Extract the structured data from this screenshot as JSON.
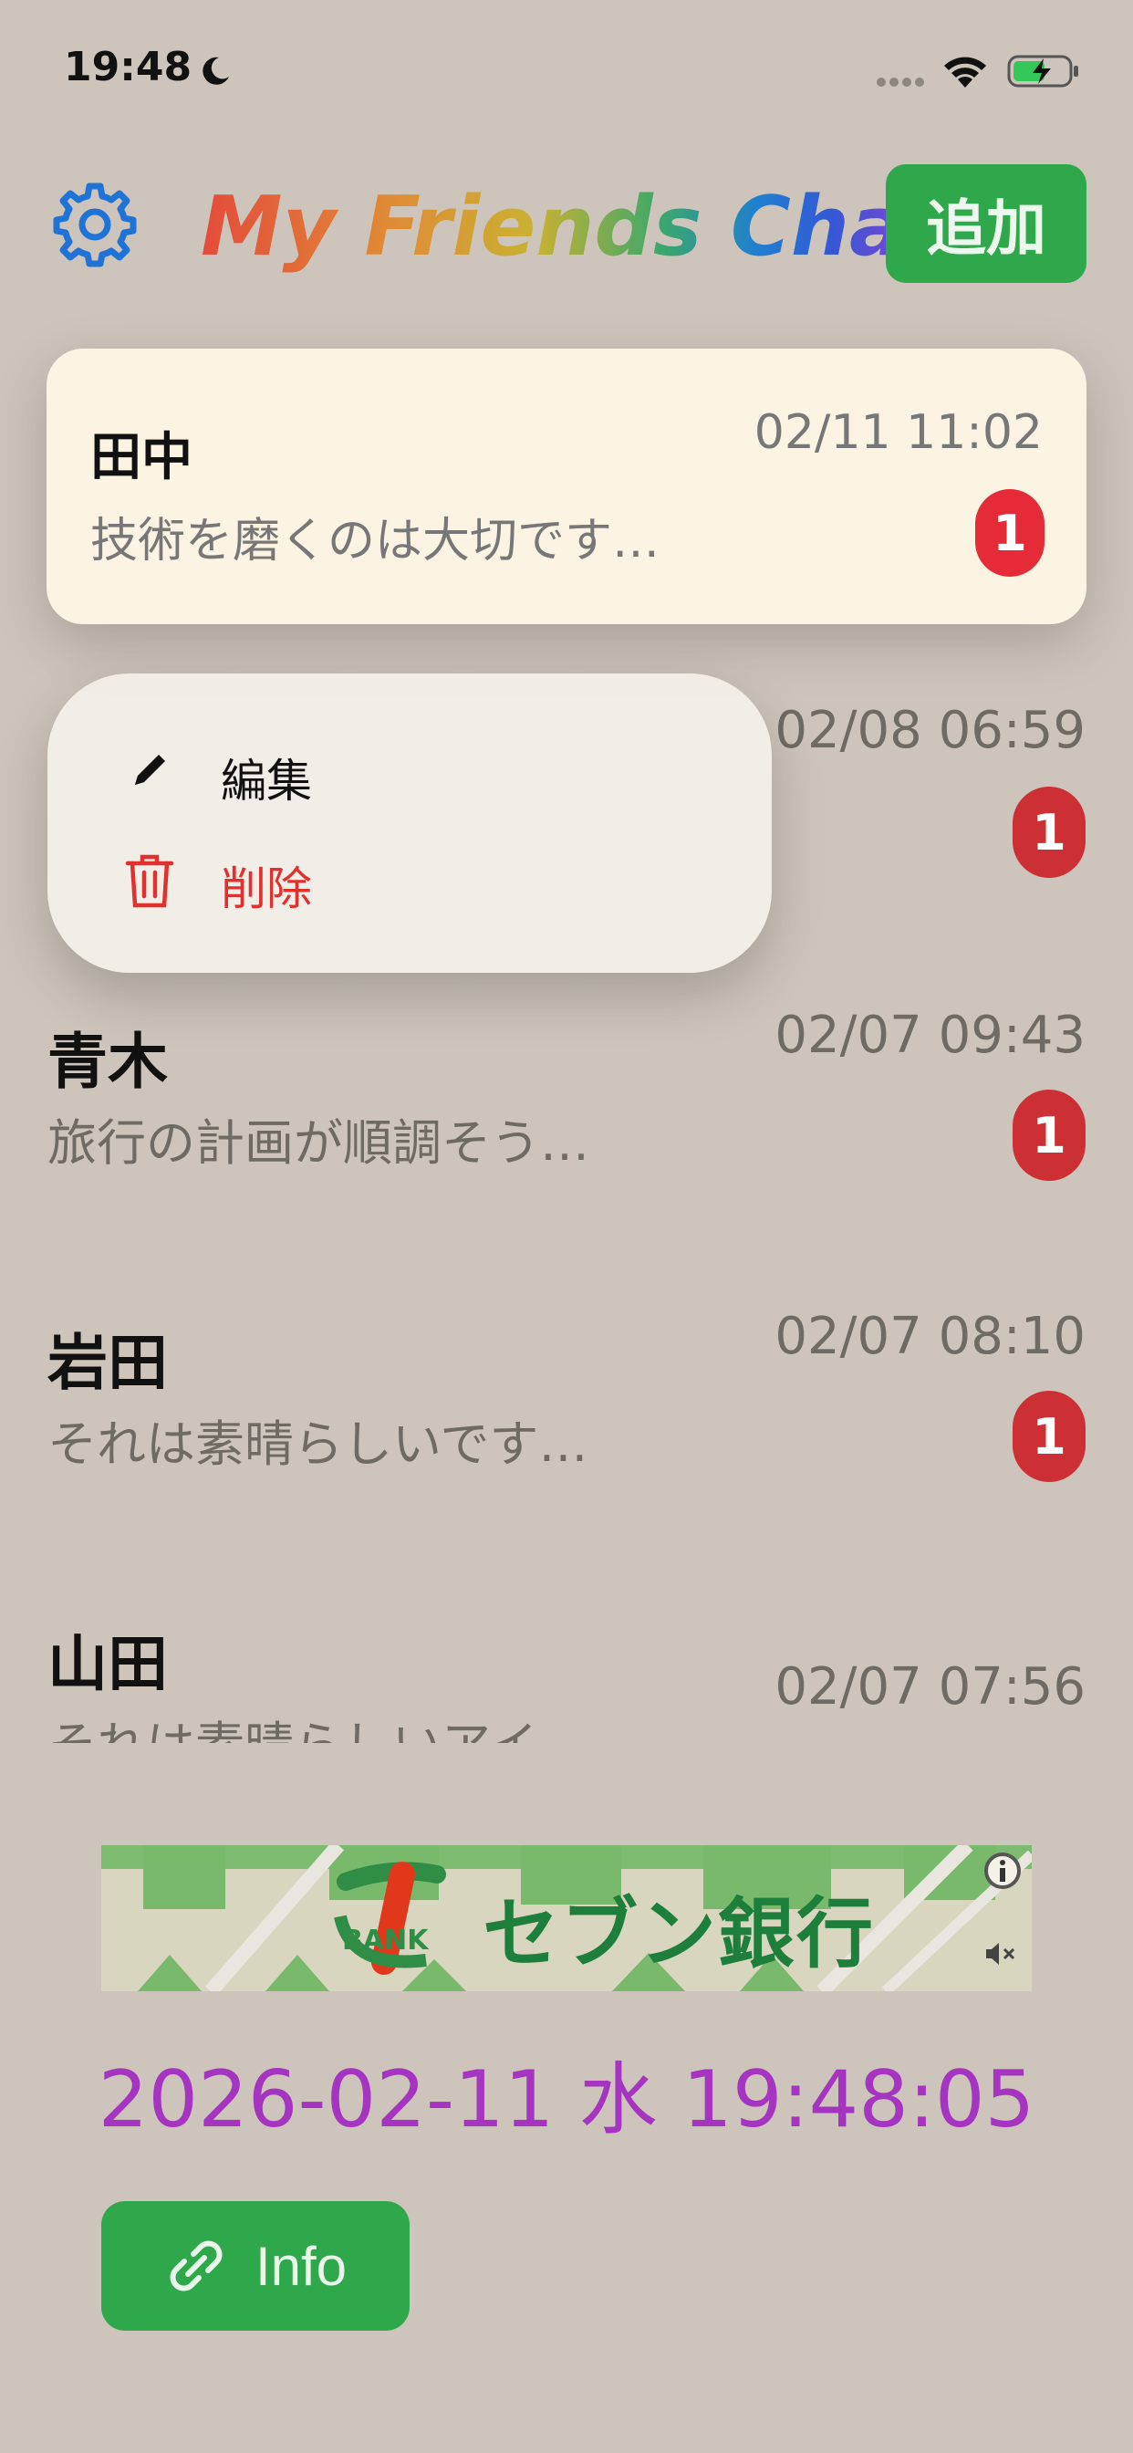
{
  "status_bar": {
    "time": "19:48"
  },
  "header": {
    "title": "My Friends Chat",
    "add_label": "追加"
  },
  "highlighted": {
    "name": "田中",
    "message": "技術を磨くのは大切です…",
    "time": "02/11 11:02",
    "badge": "1"
  },
  "context_menu": {
    "edit_label": "編集",
    "delete_label": "削除"
  },
  "rows": [
    {
      "name": "",
      "message": "",
      "time": "02/08 06:59",
      "badge": "1"
    },
    {
      "name": "青木",
      "message": "旅行の計画が順調そう…",
      "time": "02/07 09:43",
      "badge": "1"
    },
    {
      "name": "岩田",
      "message": "それは素晴らしいです…",
      "time": "02/07 08:10",
      "badge": "1"
    },
    {
      "name": "山田",
      "message": "それは素晴らしいアイ…",
      "time": "02/07 07:56"
    }
  ],
  "ad": {
    "brand_text": "セブン銀行",
    "logo_text": "BANK"
  },
  "clock": "2026-02-11 水 19:48:05",
  "info_button": {
    "label": "Info"
  },
  "colors": {
    "accent_green": "#2ea84b",
    "badge_red": "#e52b38",
    "clock_purple": "#a535c0",
    "gear_blue": "#1f73d6",
    "delete_red": "#e0312f"
  }
}
